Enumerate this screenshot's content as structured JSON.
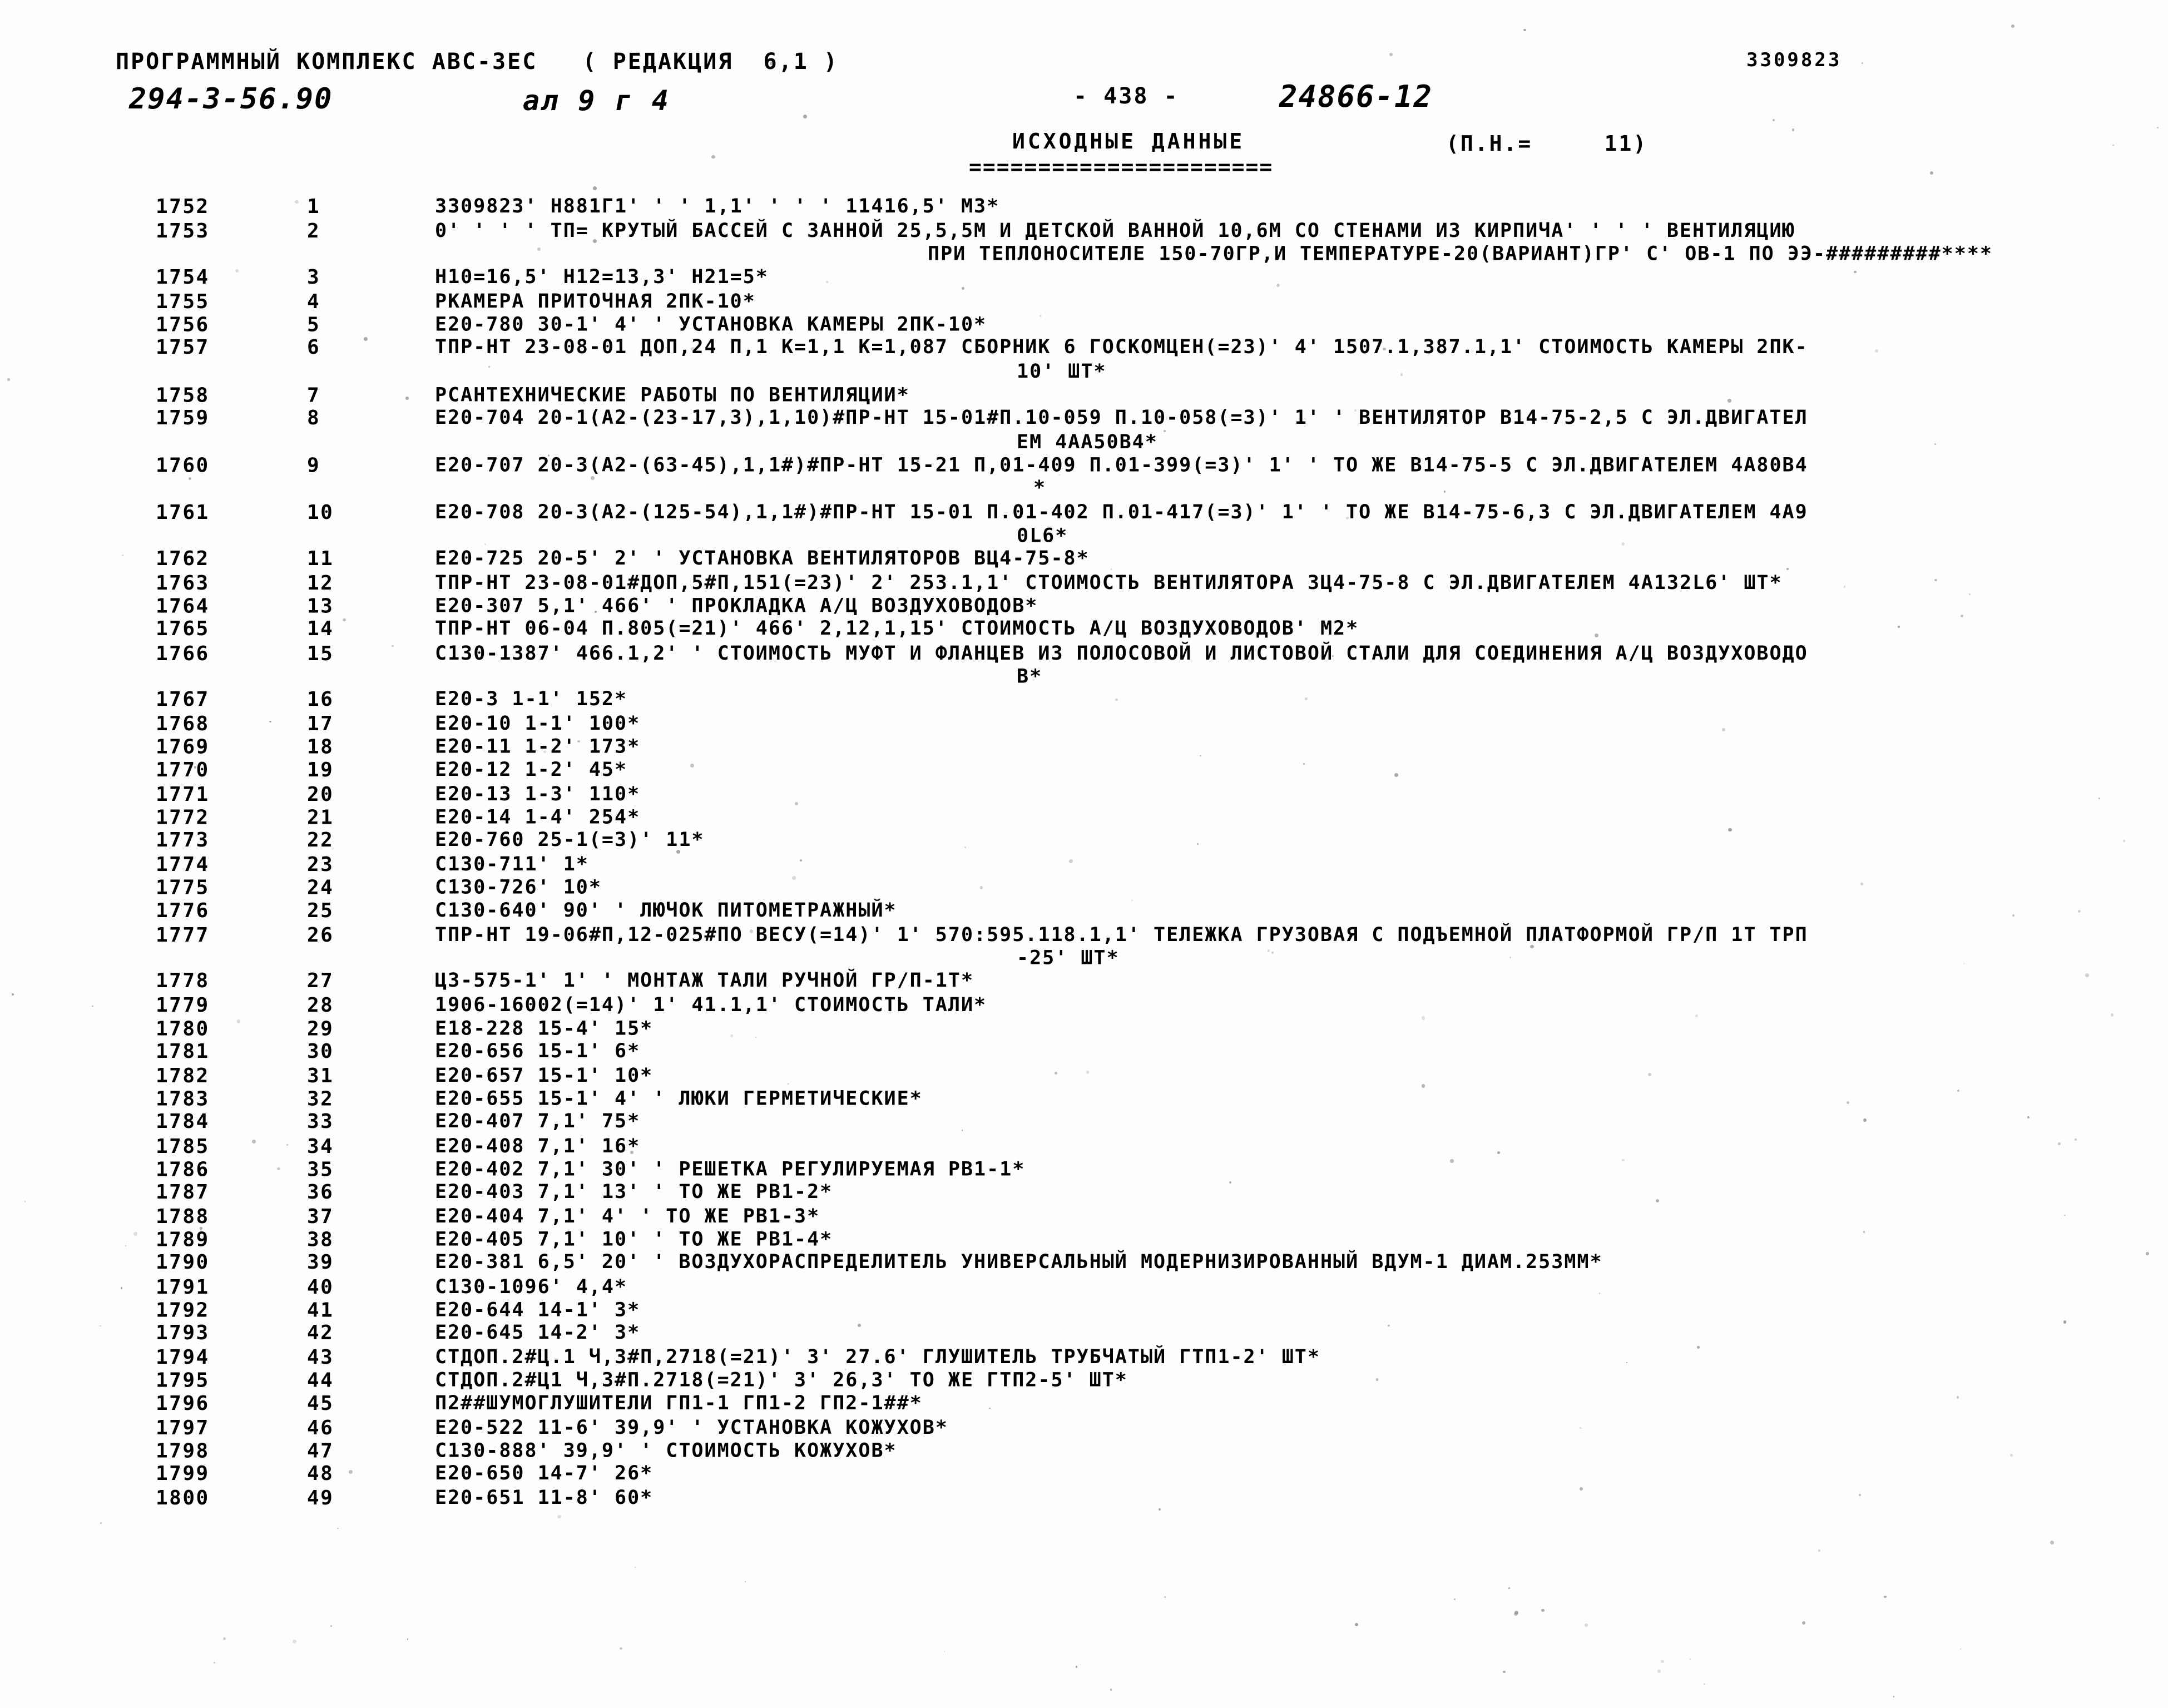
{
  "header": {
    "program_complex": "ПРОГРАММНЫЙ КОМПЛЕКС АВС-3ЕС   ( РЕДАКЦИЯ  6,1 )",
    "document_number": "294-3-56.90",
    "sheet_label": "ал 9 г 4",
    "page_marker": "- 438 -",
    "order_number": "24866-12",
    "object_code": "3309823",
    "section_title": "ИСХОДНЫЕ ДАННЫЕ",
    "pn_label": "(П.Н.=     11)",
    "rule": "======================"
  },
  "columns": {
    "seq_header": "",
    "num_header": "",
    "text_header": ""
  },
  "rows": [
    {
      "seq": "1752",
      "num": "1",
      "text": "3309823' Н881Г1' ' ' 1,1' ' ' ' 11416,5' М3*"
    },
    {
      "seq": "1753",
      "num": "2",
      "text": "0' ' ' ' ТП= КРУТЫЙ БАССЕЙ С ЗАННОЙ 25,5,5М И ДЕТСКОЙ ВАННОЙ 10,6М СО СТЕНАМИ ИЗ КИРПИЧА' ' ' ' ВЕНТИЛЯЦИЮ"
    },
    {
      "seq": "",
      "num": "",
      "text": "ПРИ ТЕПЛОНОСИТЕЛЕ 150-70ГР,И ТЕМПЕРАТУРЕ-20(ВАРИАНТ)ГР' С' ОВ-1 ПО ЭЭ-#########****",
      "cont": 1
    },
    {
      "seq": "1754",
      "num": "3",
      "text": "Н10=16,5' Н12=13,3' Н21=5*"
    },
    {
      "seq": "1755",
      "num": "4",
      "text": "РКАМЕРА ПРИТОЧНАЯ 2ПК-10*"
    },
    {
      "seq": "1756",
      "num": "5",
      "text": "Е20-780 30-1' 4' ' УСТАНОВКА КАМЕРЫ 2ПК-10*"
    },
    {
      "seq": "1757",
      "num": "6",
      "text": "ТПР-НТ 23-08-01 ДОП,24 П,1 К=1,1 К=1,087 СБОРНИК 6 ГОСКОМЦЕН(=23)' 4' 1507.1,387.1,1' СТОИМОСТЬ КАМЕРЫ 2ПК-"
    },
    {
      "seq": "",
      "num": "",
      "text": "10' ШТ*",
      "cont": 2
    },
    {
      "seq": "1758",
      "num": "7",
      "text": "РСАНТЕХНИЧЕСКИЕ РАБОТЫ ПО ВЕНТИЛЯЦИИ*"
    },
    {
      "seq": "1759",
      "num": "8",
      "text": "Е20-704 20-1(А2-(23-17,3),1,10)#ПР-НТ 15-01#П.10-059 П.10-058(=3)' 1' ' ВЕНТИЛЯТОР В14-75-2,5 С ЭЛ.ДВИГАТЕЛ"
    },
    {
      "seq": "",
      "num": "",
      "text": "ЕМ 4АА50В4*",
      "cont": 2
    },
    {
      "seq": "1760",
      "num": "9",
      "text": "Е20-707 20-3(А2-(63-45),1,1#)#ПР-НТ 15-21 П,01-409 П.01-399(=3)' 1' ' ТО ЖЕ В14-75-5 С ЭЛ.ДВИГАТЕЛЕМ 4А80В4"
    },
    {
      "seq": "",
      "num": "",
      "text": "*",
      "cont": 3
    },
    {
      "seq": "1761",
      "num": "10",
      "text": "Е20-708 20-3(А2-(125-54),1,1#)#ПР-НТ 15-01 П.01-402 П.01-417(=3)' 1' ' ТО ЖЕ В14-75-6,3 С ЭЛ.ДВИГАТЕЛЕМ 4А9"
    },
    {
      "seq": "",
      "num": "",
      "text": "0L6*",
      "cont": 2
    },
    {
      "seq": "1762",
      "num": "11",
      "text": "Е20-725 20-5' 2' ' УСТАНОВКА ВЕНТИЛЯТОРОВ ВЦ4-75-8*"
    },
    {
      "seq": "1763",
      "num": "12",
      "text": "ТПР-НТ 23-08-01#ДОП,5#П,151(=23)' 2' 253.1,1' СТОИМОСТЬ ВЕНТИЛЯТОРА ЗЦ4-75-8 С ЭЛ.ДВИГАТЕЛЕМ 4А132L6' ШТ*"
    },
    {
      "seq": "1764",
      "num": "13",
      "text": "Е20-307 5,1' 466' ' ПРОКЛАДКА А/Ц ВОЗДУХОВОДОВ*"
    },
    {
      "seq": "1765",
      "num": "14",
      "text": "ТПР-НТ 06-04 П.805(=21)' 466' 2,12,1,15' СТОИМОСТЬ А/Ц ВОЗДУХОВОДОВ' М2*"
    },
    {
      "seq": "1766",
      "num": "15",
      "text": "С130-1387' 466.1,2' ' СТОИМОСТЬ МУФТ И ФЛАНЦЕВ ИЗ ПОЛОСОВОЙ И ЛИСТОВОЙ СТАЛИ ДЛЯ СОЕДИНЕНИЯ А/Ц ВОЗДУХОВОДО"
    },
    {
      "seq": "",
      "num": "",
      "text": "В*",
      "cont": 2
    },
    {
      "seq": "1767",
      "num": "16",
      "text": "Е20-3 1-1' 152*"
    },
    {
      "seq": "1768",
      "num": "17",
      "text": "Е20-10 1-1' 100*"
    },
    {
      "seq": "1769",
      "num": "18",
      "text": "Е20-11 1-2' 173*"
    },
    {
      "seq": "1770",
      "num": "19",
      "text": "Е20-12 1-2' 45*"
    },
    {
      "seq": "1771",
      "num": "20",
      "text": "Е20-13 1-3' 110*"
    },
    {
      "seq": "1772",
      "num": "21",
      "text": "Е20-14 1-4' 254*"
    },
    {
      "seq": "1773",
      "num": "22",
      "text": "Е20-760 25-1(=3)' 11*"
    },
    {
      "seq": "1774",
      "num": "23",
      "text": "С130-711' 1*"
    },
    {
      "seq": "1775",
      "num": "24",
      "text": "С130-726' 10*"
    },
    {
      "seq": "1776",
      "num": "25",
      "text": "С130-640' 90' ' ЛЮЧОК ПИТОМЕТРАЖНЫЙ*"
    },
    {
      "seq": "1777",
      "num": "26",
      "text": "ТПР-НТ 19-06#П,12-025#ПО ВЕСУ(=14)' 1' 570:595.118.1,1' ТЕЛЕЖКА ГРУЗОВАЯ С ПОДЪЕМНОЙ ПЛАТФОРМОЙ ГР/П 1Т ТРП"
    },
    {
      "seq": "",
      "num": "",
      "text": "-25' ШТ*",
      "cont": 2
    },
    {
      "seq": "1778",
      "num": "27",
      "text": "Ц3-575-1' 1' ' МОНТАЖ ТАЛИ РУЧНОЙ ГР/П-1Т*"
    },
    {
      "seq": "1779",
      "num": "28",
      "text": "1906-16002(=14)' 1' 41.1,1' СТОИМОСТЬ ТАЛИ*"
    },
    {
      "seq": "1780",
      "num": "29",
      "text": "Е18-228 15-4' 15*"
    },
    {
      "seq": "1781",
      "num": "30",
      "text": "Е20-656 15-1' 6*"
    },
    {
      "seq": "1782",
      "num": "31",
      "text": "Е20-657 15-1' 10*"
    },
    {
      "seq": "1783",
      "num": "32",
      "text": "Е20-655 15-1' 4' ' ЛЮКИ ГЕРМЕТИЧЕСКИЕ*"
    },
    {
      "seq": "1784",
      "num": "33",
      "text": "Е20-407 7,1' 75*"
    },
    {
      "seq": "1785",
      "num": "34",
      "text": "Е20-408 7,1' 16*"
    },
    {
      "seq": "1786",
      "num": "35",
      "text": "Е20-402 7,1' 30' ' РЕШЕТКА РЕГУЛИРУЕМАЯ РВ1-1*"
    },
    {
      "seq": "1787",
      "num": "36",
      "text": "Е20-403 7,1' 13' ' ТО ЖЕ РВ1-2*"
    },
    {
      "seq": "1788",
      "num": "37",
      "text": "Е20-404 7,1' 4' ' ТО ЖЕ РВ1-3*"
    },
    {
      "seq": "1789",
      "num": "38",
      "text": "Е20-405 7,1' 10' ' ТО ЖЕ РВ1-4*"
    },
    {
      "seq": "1790",
      "num": "39",
      "text": "Е20-381 6,5' 20' ' ВОЗДУХОРАСПРЕДЕЛИТЕЛЬ УНИВЕРСАЛЬНЫЙ МОДЕРНИЗИРОВАННЫЙ ВДУМ-1 ДИАМ.253ММ*"
    },
    {
      "seq": "1791",
      "num": "40",
      "text": "С130-1096' 4,4*"
    },
    {
      "seq": "1792",
      "num": "41",
      "text": "Е20-644 14-1' 3*"
    },
    {
      "seq": "1793",
      "num": "42",
      "text": "Е20-645 14-2' 3*"
    },
    {
      "seq": "1794",
      "num": "43",
      "text": "СТДОП.2#Ц.1 Ч,3#П,2718(=21)' 3' 27.6' ГЛУШИТЕЛЬ ТРУБЧАТЫЙ ГТП1-2' ШТ*"
    },
    {
      "seq": "1795",
      "num": "44",
      "text": "СТДОП.2#Ц1 Ч,3#П.2718(=21)' 3' 26,3' ТО ЖЕ ГТП2-5' ШТ*"
    },
    {
      "seq": "1796",
      "num": "45",
      "text": "П2##ШУМОГЛУШИТЕЛИ ГП1-1 ГП1-2 ГП2-1##*"
    },
    {
      "seq": "1797",
      "num": "46",
      "text": "Е20-522 11-6' 39,9' ' УСТАНОВКА КОЖУХОВ*"
    },
    {
      "seq": "1798",
      "num": "47",
      "text": "С130-888' 39,9' ' СТОИМОСТЬ КОЖУХОВ*"
    },
    {
      "seq": "1799",
      "num": "48",
      "text": "Е20-650 14-7' 26*"
    },
    {
      "seq": "1800",
      "num": "49",
      "text": "Е20-651 11-8' 60*"
    }
  ]
}
